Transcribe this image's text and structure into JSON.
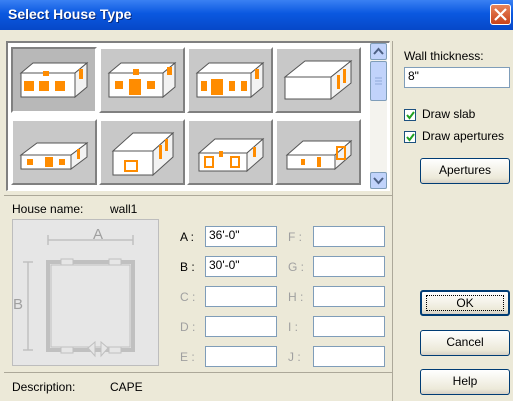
{
  "window": {
    "title": "Select House Type"
  },
  "gallery": {
    "items": [
      {
        "icon": "house-3d-icon",
        "selected": true
      },
      {
        "icon": "house-3d-icon",
        "selected": false
      },
      {
        "icon": "house-3d-icon",
        "selected": false
      },
      {
        "icon": "house-3d-icon",
        "selected": false
      },
      {
        "icon": "house-3d-icon",
        "selected": false
      },
      {
        "icon": "house-3d-icon",
        "selected": false
      },
      {
        "icon": "house-3d-icon",
        "selected": false
      },
      {
        "icon": "house-3d-icon",
        "selected": false
      }
    ],
    "accent_color": "#ff8c00"
  },
  "settings": {
    "wall_thickness_label": "Wall thickness:",
    "wall_thickness_value": "8\"",
    "draw_slab_label": "Draw slab",
    "draw_slab_checked": true,
    "draw_apertures_label": "Draw apertures",
    "draw_apertures_checked": true,
    "apertures_button": "Apertures"
  },
  "house": {
    "name_label": "House name:",
    "name_value": "wall1",
    "preview_labels": {
      "a": "A",
      "b": "B"
    },
    "description_label": "Description:",
    "description_value": "CAPE"
  },
  "dimensions": {
    "a_label": "A :",
    "a_value": "36'-0\"",
    "b_label": "B :",
    "b_value": "30'-0\"",
    "c_label": "C :",
    "c_value": "",
    "d_label": "D :",
    "d_value": "",
    "e_label": "E :",
    "e_value": "",
    "f_label": "F :",
    "f_value": "",
    "g_label": "G :",
    "g_value": "",
    "h_label": "H :",
    "h_value": "",
    "i_label": "I :",
    "i_value": "",
    "j_label": "J :",
    "j_value": ""
  },
  "buttons": {
    "ok": "OK",
    "cancel": "Cancel",
    "help": "Help"
  }
}
